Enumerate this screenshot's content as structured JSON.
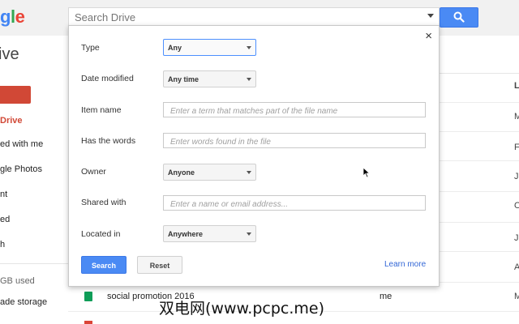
{
  "header": {
    "logo_letters": [
      "g",
      "l",
      "e"
    ],
    "search_placeholder": "Search Drive"
  },
  "subheader": {
    "title": "ive"
  },
  "sidebar": {
    "new_button": "",
    "items": [
      {
        "label": "Drive",
        "active": true
      },
      {
        "label": "ed with me"
      },
      {
        "label": "gle Photos"
      },
      {
        "label": "nt"
      },
      {
        "label": "ed"
      },
      {
        "label": "h"
      },
      {
        "label": "GB used"
      },
      {
        "label": "ade storage"
      }
    ]
  },
  "file_list": {
    "right_column_header": "L",
    "right_column_values": [
      "M",
      "F",
      "J",
      "O",
      "J",
      "A",
      "M"
    ],
    "visible_row": {
      "name": "social promotion 2016",
      "owner": "me"
    }
  },
  "search_panel": {
    "close_icon": "×",
    "type": {
      "label": "Type",
      "value": "Any"
    },
    "date_modified": {
      "label": "Date modified",
      "value": "Any time"
    },
    "item_name": {
      "label": "Item name",
      "placeholder": "Enter a term that matches part of the file name"
    },
    "has_words": {
      "label": "Has the words",
      "placeholder": "Enter words found in the file"
    },
    "owner": {
      "label": "Owner",
      "value": "Anyone"
    },
    "shared_with": {
      "label": "Shared with",
      "placeholder": "Enter a name or email address..."
    },
    "located_in": {
      "label": "Located in",
      "value": "Anywhere"
    },
    "search_button": "Search",
    "reset_button": "Reset",
    "learn_more": "Learn more"
  },
  "watermark": "双电网(www.pcpc.me)",
  "colors": {
    "accent_blue": "#4a8af4",
    "new_red": "#d14836",
    "link_blue": "#3367d6"
  }
}
